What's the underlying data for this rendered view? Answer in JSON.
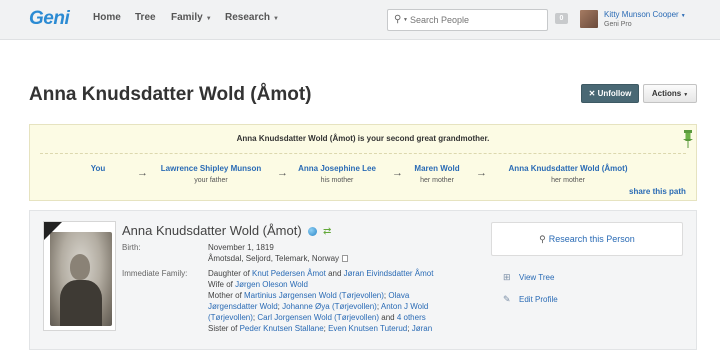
{
  "header": {
    "logo": "Geni",
    "nav": [
      {
        "label": "Home",
        "has_menu": false
      },
      {
        "label": "Tree",
        "has_menu": false
      },
      {
        "label": "Family",
        "has_menu": true
      },
      {
        "label": "Research",
        "has_menu": true
      }
    ],
    "search_placeholder": "Search People",
    "message_count": "0",
    "user_name": "Kitty Munson Cooper",
    "user_plan": "Geni Pro"
  },
  "page": {
    "title": "Anna Knudsdatter Wold (Åmot)",
    "unfollow_label": "Unfollow",
    "actions_label": "Actions"
  },
  "relationship": {
    "sentence": "Anna Knudsdatter Wold (Åmot) is your second great grandmother.",
    "chain": [
      {
        "name": "You",
        "relation": ""
      },
      {
        "name": "Lawrence Shipley Munson",
        "relation": "your father"
      },
      {
        "name": "Anna Josephine Lee",
        "relation": "his mother"
      },
      {
        "name": "Maren Wold",
        "relation": "her mother"
      },
      {
        "name": "Anna Knudsdatter Wold (Åmot)",
        "relation": "her mother"
      }
    ],
    "arrow": "→",
    "share_label": "share this path"
  },
  "profile": {
    "name": "Anna Knudsdatter Wold (Åmot)",
    "birth_label": "Birth:",
    "birth_date": "November 1, 1819",
    "birth_place": "Åmotsdal, Seljord, Telemark, Norway",
    "family_label": "Immediate Family:",
    "family": {
      "daughter_prefix": "Daughter of ",
      "father": "Knut Pedersen Åmot",
      "and": " and ",
      "mother": "Jøran Eivindsdatter Åmot",
      "wife_prefix": "Wife of ",
      "husband": "Jørgen Oleson Wold",
      "mother_prefix": "Mother of ",
      "child1": "Martinius Jørgensen Wold (Tørjevollen)",
      "sep": "; ",
      "child2_a": "Olava",
      "child2_b": "Jørgensdatter Wold",
      "child3": "Johanne Øya (Tørjevollen)",
      "child4_a": "Anton J Wold",
      "child4_b": "(Tørjevollen)",
      "child5": "Carl Jorgensen Wold (Tørjevollen)",
      "and2": " and ",
      "others": "4 others",
      "sister_prefix": "Sister of ",
      "sib1": "Peder Knutsen Stallane",
      "sib2": "Even Knutsen Tuterud",
      "sib3": "Jøran"
    },
    "research_label": "Research this Person",
    "view_tree_label": "View Tree",
    "edit_profile_label": "Edit Profile"
  }
}
